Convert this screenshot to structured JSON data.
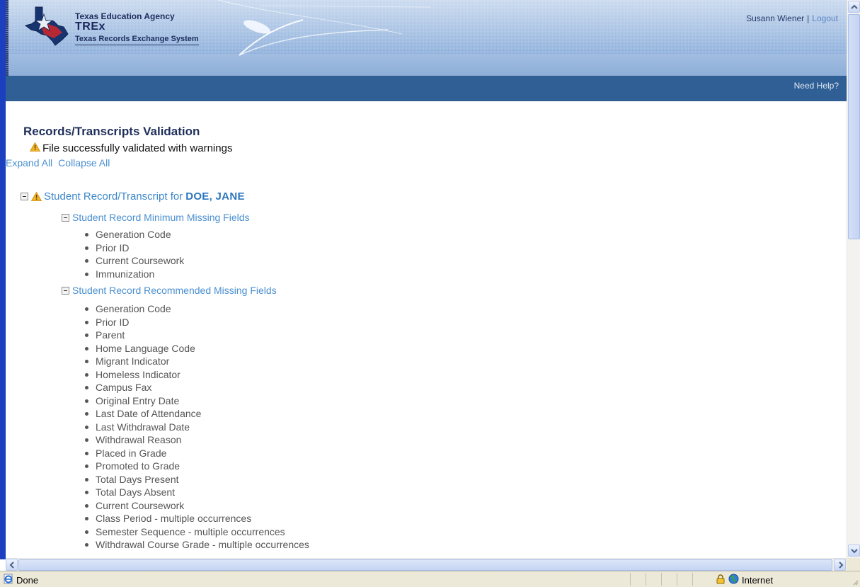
{
  "header": {
    "org_name": "Texas Education Agency",
    "app_name": "TREx",
    "app_full_name": "Texas Records Exchange System",
    "user_name": "Susann Wiener",
    "separator": "|",
    "logout_label": "Logout"
  },
  "nav": {
    "help_label": "Need Help?"
  },
  "main": {
    "title": "Records/Transcripts Validation",
    "status_message": "File successfully validated with warnings",
    "expand_all_label": "Expand All",
    "collapse_all_label": "Collapse All",
    "record": {
      "heading_prefix": "Student Record/Transcript for",
      "student_name": "DOE, JANE",
      "sections": [
        {
          "label": "Student Record Minimum Missing Fields",
          "items": [
            "Generation Code",
            "Prior ID",
            "Current Coursework",
            "Immunization"
          ]
        },
        {
          "label": "Student Record Recommended Missing Fields",
          "items": [
            "Generation Code",
            "Prior ID",
            "Parent",
            "Home Language Code",
            "Migrant Indicator",
            "Homeless Indicator",
            "Campus Fax",
            "Original Entry Date",
            "Last Date of Attendance",
            "Last Withdrawal Date",
            "Withdrawal Reason",
            "Placed in Grade",
            "Promoted to Grade",
            "Total Days Present",
            "Total Days Absent",
            "Current Coursework",
            "Class Period - multiple occurrences",
            "Semester Sequence - multiple occurrences",
            "Withdrawal Course Grade - multiple occurrences"
          ]
        }
      ]
    }
  },
  "statusbar": {
    "status_text": "Done",
    "zone_label": "Internet"
  },
  "colors": {
    "nav_bar": "#2f5f95",
    "link": "#4a8fd0",
    "warning": "#f0b429",
    "title": "#1f2f5b"
  }
}
